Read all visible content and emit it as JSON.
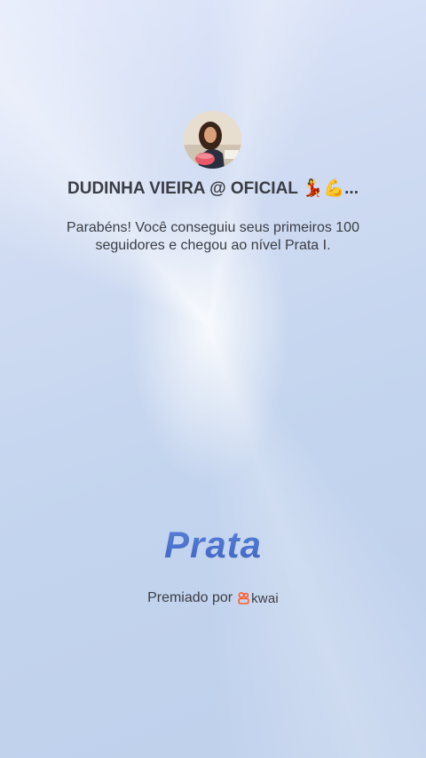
{
  "profile": {
    "username": "DUDINHA VIEIRA @ OFICIAL 💃💪..."
  },
  "achievement": {
    "message": "Parabéns! Você conseguiu seus primeiros 100 seguidores e chegou ao nível Prata I.",
    "level_title": "Prata"
  },
  "footer": {
    "awarded_by_label": "Premiado por",
    "brand_name": "kwai",
    "brand_color": "#ff5a2c"
  },
  "colors": {
    "accent": "#4a70cf",
    "text": "#3a3d45"
  }
}
